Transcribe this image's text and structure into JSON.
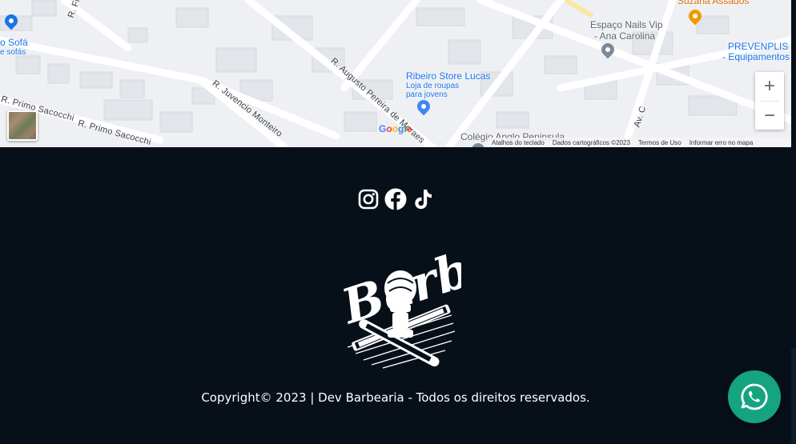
{
  "map": {
    "streets": {
      "frontal": "R. Fr",
      "juvencio": "R. Juvencio Monteiro",
      "augusto": "R. Augusto Pereira de Moraes",
      "primo1": "R. Primo Sacocchi",
      "primo2": "R. Primo Sacocchi",
      "av_c": "Av. C"
    },
    "pois": {
      "sofa_title": "o Sofá",
      "sofa_sub": "e sofás",
      "ribeiro_title": "Ribeiro Store Lucas",
      "ribeiro_sub1": "Loja de roupas",
      "ribeiro_sub2": "para jovens",
      "nails_title1": "Espaço Nails Vip",
      "nails_title2": "- Ana Carolina",
      "suzana_title": "Suzana Assados",
      "preven_title1": "PREVENPLIS E",
      "preven_title2": "- Equipamentos",
      "colegio_title": "Colégio Anglo Peninsula"
    },
    "google_logo": "Google",
    "attribution": {
      "shortcuts": "Atalhos do teclado",
      "map_data": "Dados cartográficos ©2023",
      "terms": "Termos de Uso",
      "report": "Informar erro no mapa"
    },
    "zoom_in_label": "+",
    "zoom_out_label": "−"
  },
  "footer": {
    "social_icons": [
      "instagram-icon",
      "facebook-icon",
      "tiktok-icon"
    ],
    "logo_text": "Barber",
    "copyright": "Copyright© 2023 | Dev Barbearia - Todos os direitos reservados."
  },
  "whatsapp": {
    "icon": "whatsapp-icon",
    "color": "#16a37f"
  },
  "colors": {
    "background": "#070f19",
    "map_bg": "#eef0f3",
    "poi_blue": "#1a73e8",
    "poi_orange": "#d56e0c"
  }
}
